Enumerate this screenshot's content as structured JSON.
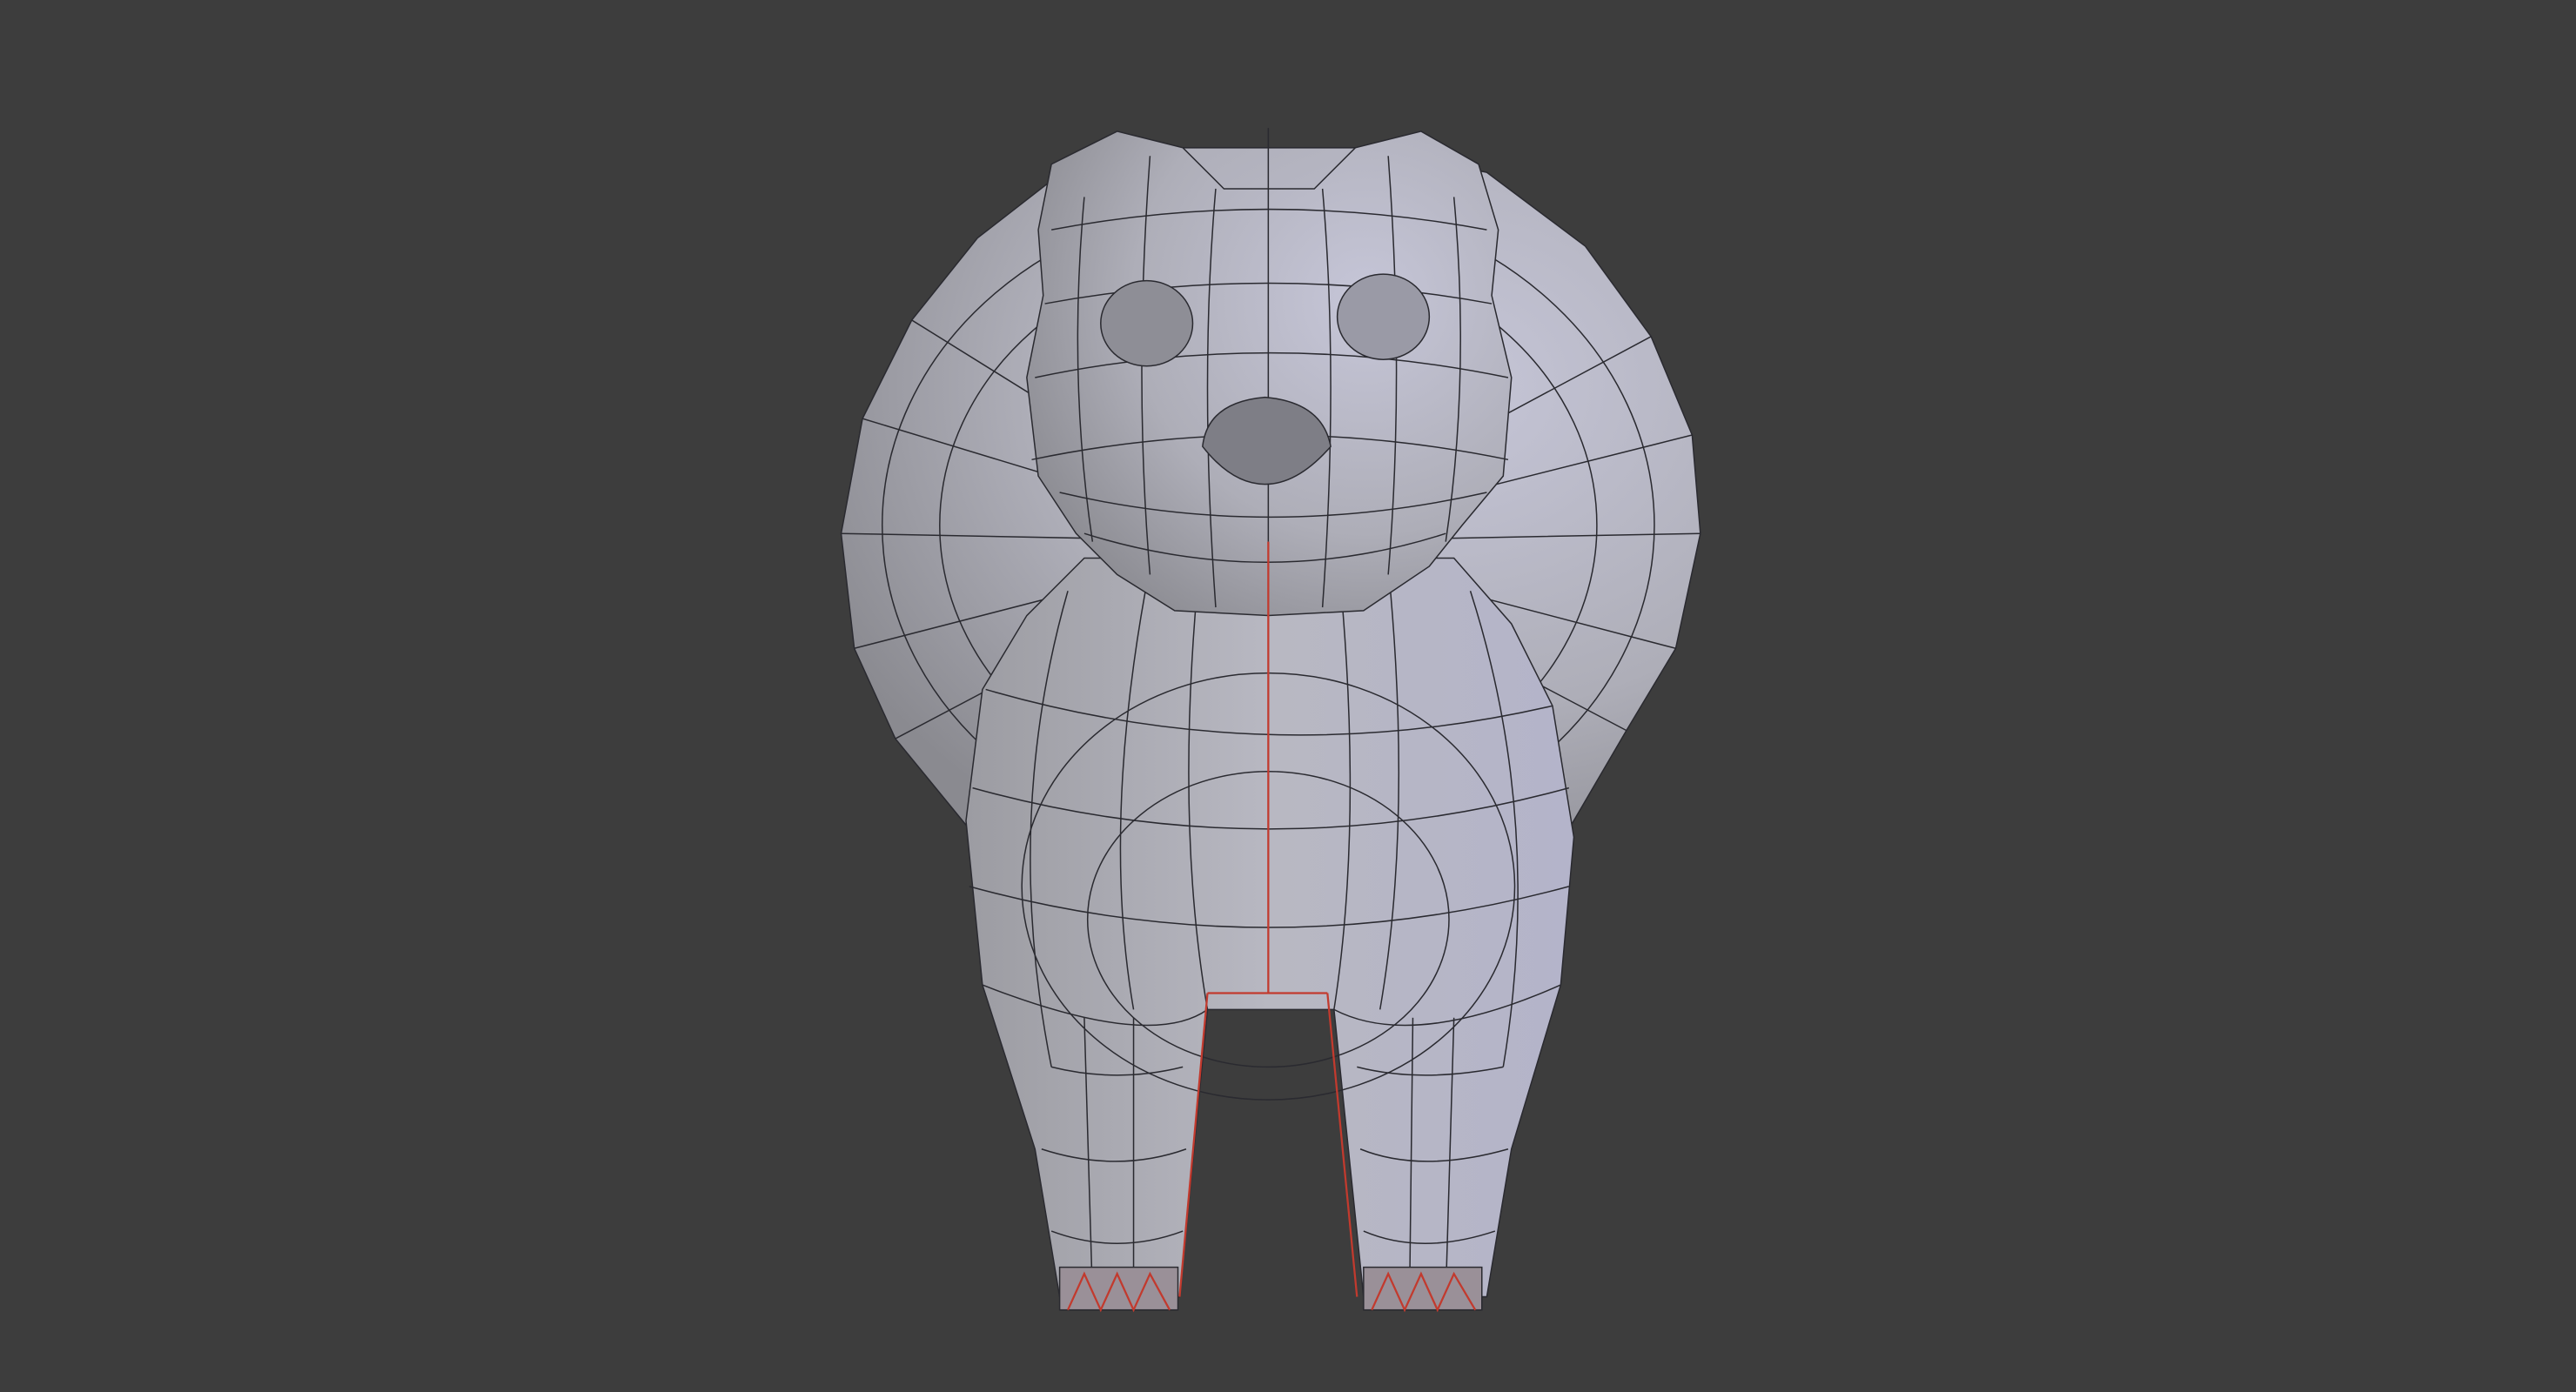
{
  "viewport": {
    "background": "#3d3d3d",
    "mesh_color_light": "#c9c9d8",
    "mesh_color_dark": "#8e8e96",
    "wire_color": "#2a2a30",
    "seam_color": "#c23a2e"
  }
}
